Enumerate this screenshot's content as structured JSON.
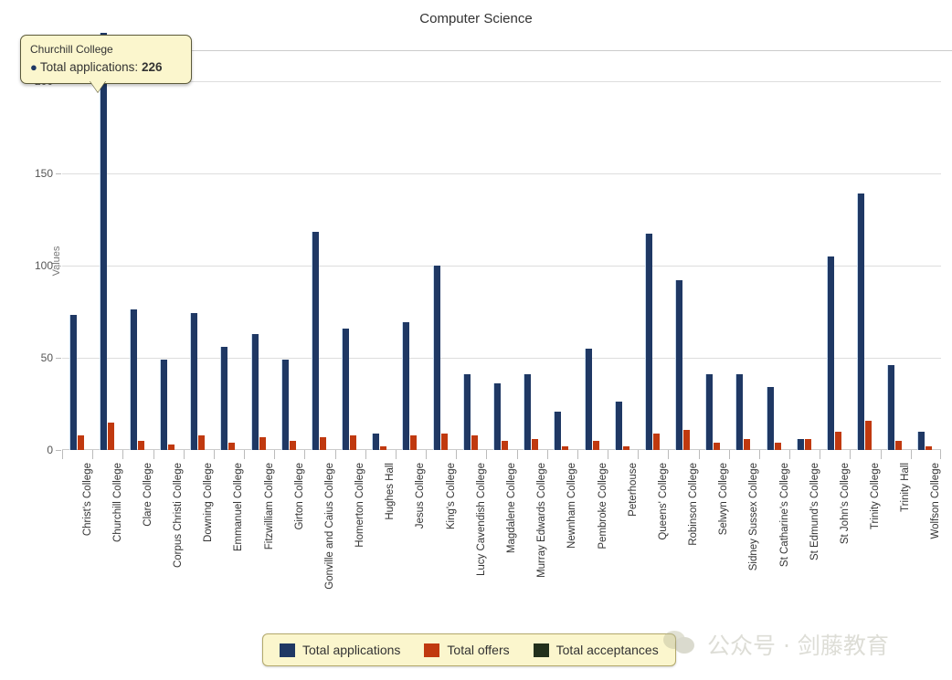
{
  "chart_data": {
    "type": "bar",
    "title": "Computer Science",
    "xlabel": "",
    "ylabel": "Values",
    "ylim": [
      0,
      226
    ],
    "yticks": [
      0,
      50,
      100,
      150,
      200
    ],
    "grid": true,
    "legend_position": "bottom",
    "categories": [
      "Christ's College",
      "Churchill College",
      "Clare College",
      "Corpus Christi College",
      "Downing College",
      "Emmanuel College",
      "Fitzwilliam College",
      "Girton College",
      "Gonville and Caius College",
      "Homerton College",
      "Hughes Hall",
      "Jesus College",
      "King's College",
      "Lucy Cavendish College",
      "Magdalene College",
      "Murray Edwards College",
      "Newnham College",
      "Pembroke College",
      "Peterhouse",
      "Queens' College",
      "Robinson College",
      "Selwyn College",
      "Sidney Sussex College",
      "St Catharine's College",
      "St Edmund's College",
      "St John's College",
      "Trinity College",
      "Trinity Hall",
      "Wolfson College"
    ],
    "series": [
      {
        "name": "Total applications",
        "color": "#1f3864",
        "values": [
          73,
          226,
          76,
          49,
          74,
          56,
          63,
          49,
          118,
          66,
          9,
          69,
          100,
          41,
          36,
          41,
          21,
          55,
          26,
          117,
          92,
          41,
          41,
          34,
          6,
          105,
          139,
          46,
          10
        ]
      },
      {
        "name": "Total offers",
        "color": "#c0390f",
        "values": [
          8,
          15,
          5,
          3,
          8,
          4,
          7,
          5,
          7,
          8,
          2,
          8,
          9,
          8,
          5,
          6,
          2,
          5,
          2,
          9,
          11,
          4,
          6,
          4,
          6,
          10,
          16,
          5,
          2
        ]
      },
      {
        "name": "Total acceptances",
        "color": "#22301c",
        "values": [
          0,
          0,
          0,
          0,
          0,
          0,
          0,
          0,
          0,
          0,
          0,
          0,
          0,
          0,
          0,
          0,
          0,
          0,
          0,
          0,
          0,
          0,
          0,
          0,
          0,
          0,
          0,
          0,
          0
        ]
      }
    ]
  },
  "tooltip": {
    "title": "Churchill College",
    "bullet": "●",
    "series_label": "Total applications:",
    "value": "226"
  },
  "watermark": {
    "text": "公众号 · 剑藤教育"
  }
}
